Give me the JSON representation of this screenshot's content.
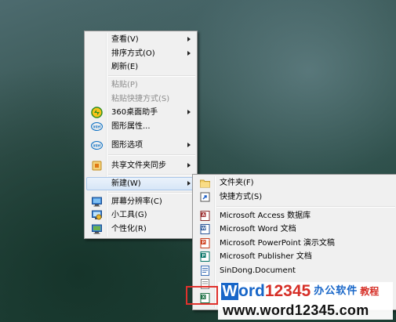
{
  "main_menu": {
    "view": "查看(V)",
    "sort_by": "排序方式(O)",
    "refresh": "刷新(E)",
    "paste": "粘贴(P)",
    "paste_shortcut": "粘贴快捷方式(S)",
    "desktop_helper_360": "360桌面助手",
    "graphics_properties": "图形属性...",
    "graphics_options": "图形选项",
    "shared_folder_sync": "共享文件夹同步",
    "new": "新建(W)",
    "screen_resolution": "屏幕分辨率(C)",
    "gadgets": "小工具(G)",
    "personalize": "个性化(R)"
  },
  "new_submenu": {
    "folder": "文件夹(F)",
    "shortcut": "快捷方式(S)",
    "access_db": "Microsoft Access 数据库",
    "word_doc": "Microsoft Word 文档",
    "powerpoint": "Microsoft PowerPoint 演示文稿",
    "publisher": "Microsoft Publisher 文档",
    "sindong": "SinDong.Document"
  },
  "watermark": {
    "logo_w": "W",
    "logo_ord": "ord",
    "logo_num": "12345",
    "logo_cn": "办公软件",
    "logo_tutorial": "教程",
    "url": "www.word12345.com"
  },
  "colors": {
    "highlight_border": "#a9c7ea",
    "annotation_red": "#e0322d",
    "brand_blue": "#1866c8",
    "brand_red": "#d62f27"
  }
}
